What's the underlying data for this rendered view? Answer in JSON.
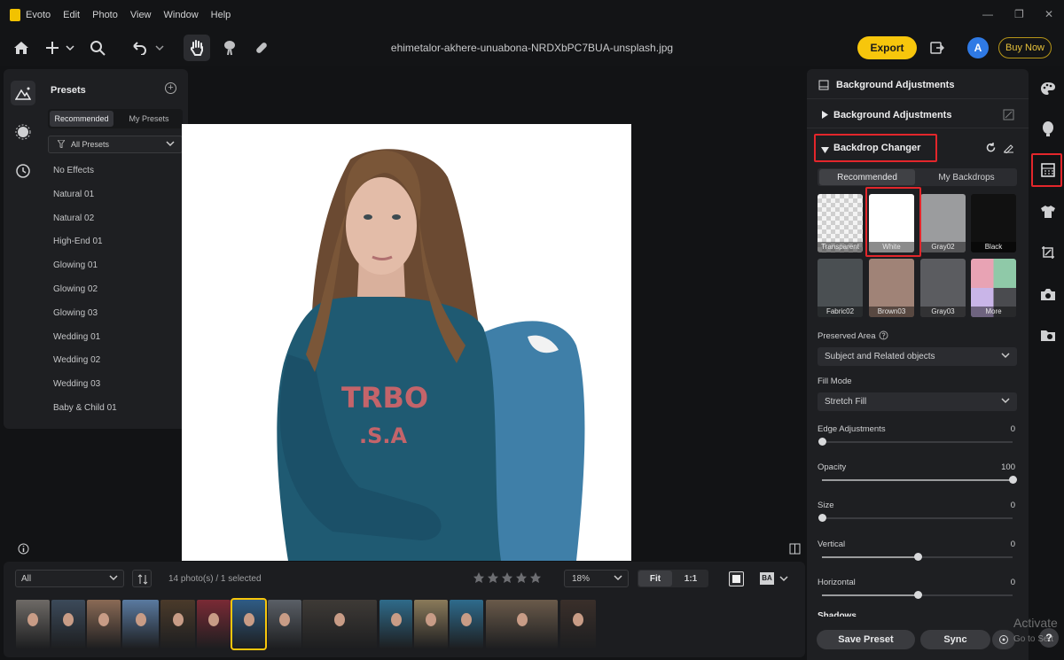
{
  "app": {
    "name": "Evoto",
    "menu": [
      "Edit",
      "Photo",
      "View",
      "Window",
      "Help"
    ],
    "filename": "ehimetalor-akhere-unuabona-NRDXbPC7BUA-unsplash.jpg",
    "export_label": "Export",
    "avatar_initial": "A",
    "buy_now_label": "Buy Now"
  },
  "presets": {
    "title": "Presets",
    "tabs": [
      "Recommended",
      "My Presets"
    ],
    "filter_label": "All Presets",
    "items": [
      "No Effects",
      "Natural 01",
      "Natural 02",
      "High-End 01",
      "Glowing 01",
      "Glowing 02",
      "Glowing 03",
      "Wedding 01",
      "Wedding 02",
      "Wedding 03",
      "Baby & Child 01"
    ]
  },
  "filmstrip": {
    "filter_value": "All",
    "count_label": "14 photo(s) / 1 selected",
    "zoom_value": "18%",
    "fit_label": "Fit",
    "one_to_one_label": "1:1",
    "ba_label": "BA",
    "thumbnails": [
      {
        "tone": "#6e6a66"
      },
      {
        "tone": "#3c4a5a"
      },
      {
        "tone": "#8a6a55"
      },
      {
        "tone": "#5a7aa0"
      },
      {
        "tone": "#4a3a2a"
      },
      {
        "tone": "#7a2a35"
      },
      {
        "tone": "#2f5c85"
      },
      {
        "tone": "#5a5f66"
      },
      {
        "tone": "#3e3a36"
      },
      {
        "tone": "#2f6b8a"
      },
      {
        "tone": "#8a7a5a"
      },
      {
        "tone": "#2e6b8c"
      },
      {
        "tone": "#6a5a4a"
      },
      {
        "tone": "#3a2f2a"
      }
    ]
  },
  "right_panel": {
    "header": "Background Adjustments",
    "section_bg": "Background Adjustments",
    "section_backdrop": "Backdrop Changer",
    "tabs": [
      "Recommended",
      "My Backdrops"
    ],
    "swatches": [
      {
        "label": "Transparent",
        "color": "checker"
      },
      {
        "label": "White",
        "color": "#ffffff"
      },
      {
        "label": "Gray02",
        "color": "#9b9c9e"
      },
      {
        "label": "Black",
        "color": "#111111"
      },
      {
        "label": "Fabric02",
        "color": "#4a4f52"
      },
      {
        "label": "Brown03",
        "color": "#a08377"
      },
      {
        "label": "Gray03",
        "color": "#5b5c60"
      },
      {
        "label": "More",
        "color": "grid"
      }
    ],
    "preserved_area_label": "Preserved Area",
    "preserved_area_value": "Subject and Related objects",
    "fill_mode_label": "Fill Mode",
    "fill_mode_value": "Stretch Fill",
    "sliders": [
      {
        "label": "Edge Adjustments",
        "value": "0",
        "level": 0
      },
      {
        "label": "Opacity",
        "value": "100",
        "level": 1
      },
      {
        "label": "Size",
        "value": "0",
        "level": 0
      },
      {
        "label": "Vertical",
        "value": "0",
        "level": 0.5
      },
      {
        "label": "Horizontal",
        "value": "0",
        "level": 0.5
      }
    ],
    "shadows_label": "Shadows",
    "save_preset_label": "Save Preset",
    "sync_label": "Sync"
  },
  "overlay": {
    "activate_text": "Activate",
    "goto_text": "Go to Sett"
  },
  "colors": {
    "accent": "#f7c60c",
    "highlight": "#e3262b",
    "avatar": "#2f7ae5"
  }
}
